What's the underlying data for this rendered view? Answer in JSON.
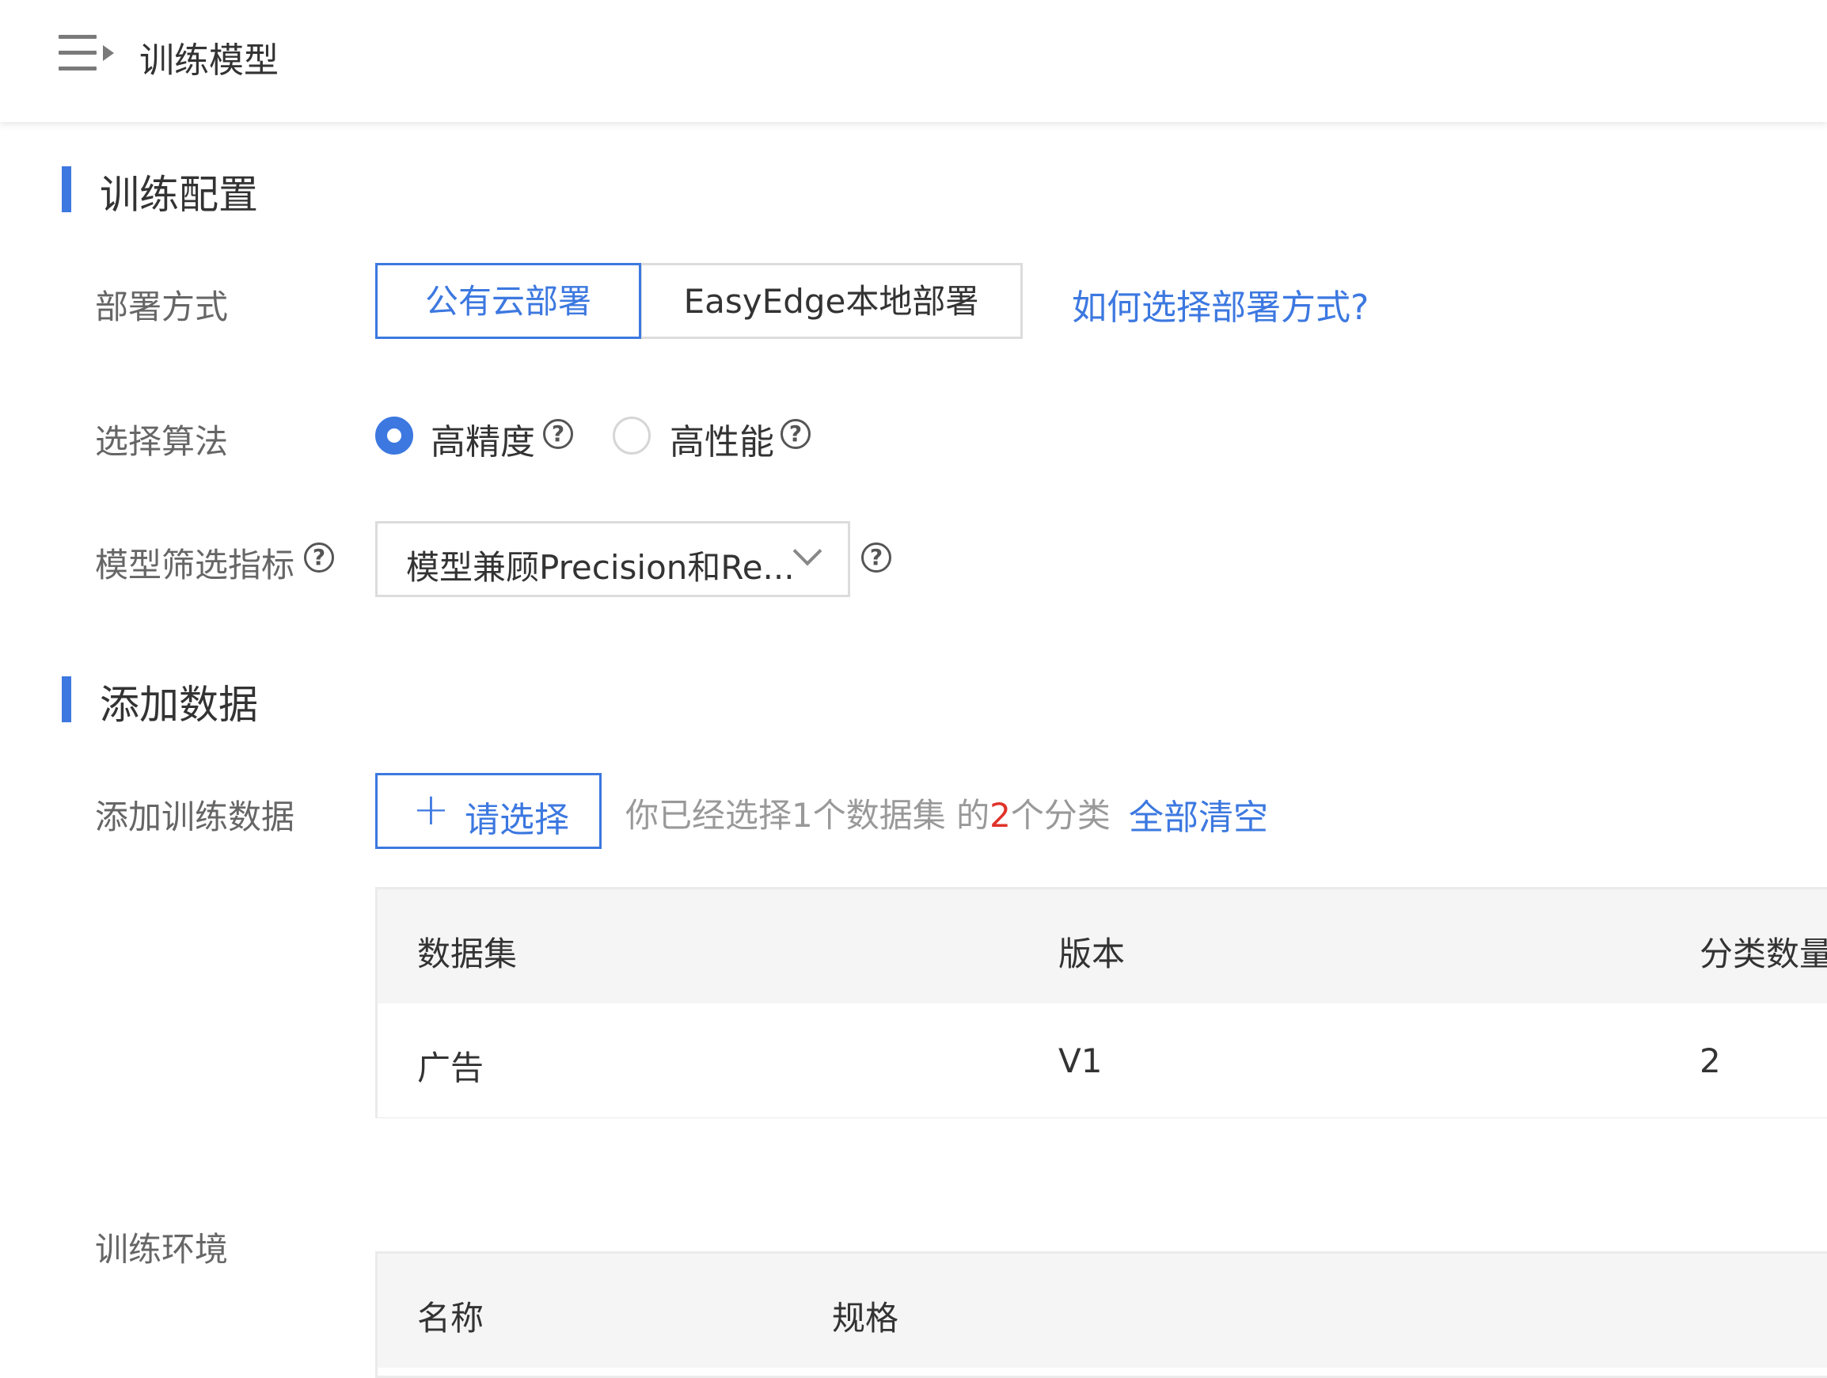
{
  "header": {
    "title": "训练模型"
  },
  "training_config": {
    "section_title": "训练配置",
    "deploy": {
      "label": "部署方式",
      "options": [
        "公有云部署",
        "EasyEdge本地部署"
      ],
      "selected": "公有云部署",
      "help_link": "如何选择部署方式?"
    },
    "algorithm": {
      "label": "选择算法",
      "options": [
        "高精度",
        "高性能"
      ],
      "selected": "高精度"
    },
    "metric": {
      "label": "模型筛选指标",
      "value": "模型兼顾Precision和Re..."
    }
  },
  "add_data": {
    "section_title": "添加数据",
    "label": "添加训练数据",
    "select_button": "请选择",
    "summary_prefix": "你已经选择1个数据集 的",
    "summary_count": "2",
    "summary_suffix": "个分类",
    "clear_all": "全部清空",
    "table": {
      "columns": [
        "数据集",
        "版本",
        "分类数量"
      ],
      "rows": [
        [
          "广告",
          "V1",
          "2"
        ]
      ]
    }
  },
  "environment": {
    "label": "训练环境",
    "table": {
      "columns": [
        "名称",
        "规格"
      ]
    }
  },
  "colors": {
    "accent": "#3c78e0",
    "danger": "#e0322a"
  }
}
